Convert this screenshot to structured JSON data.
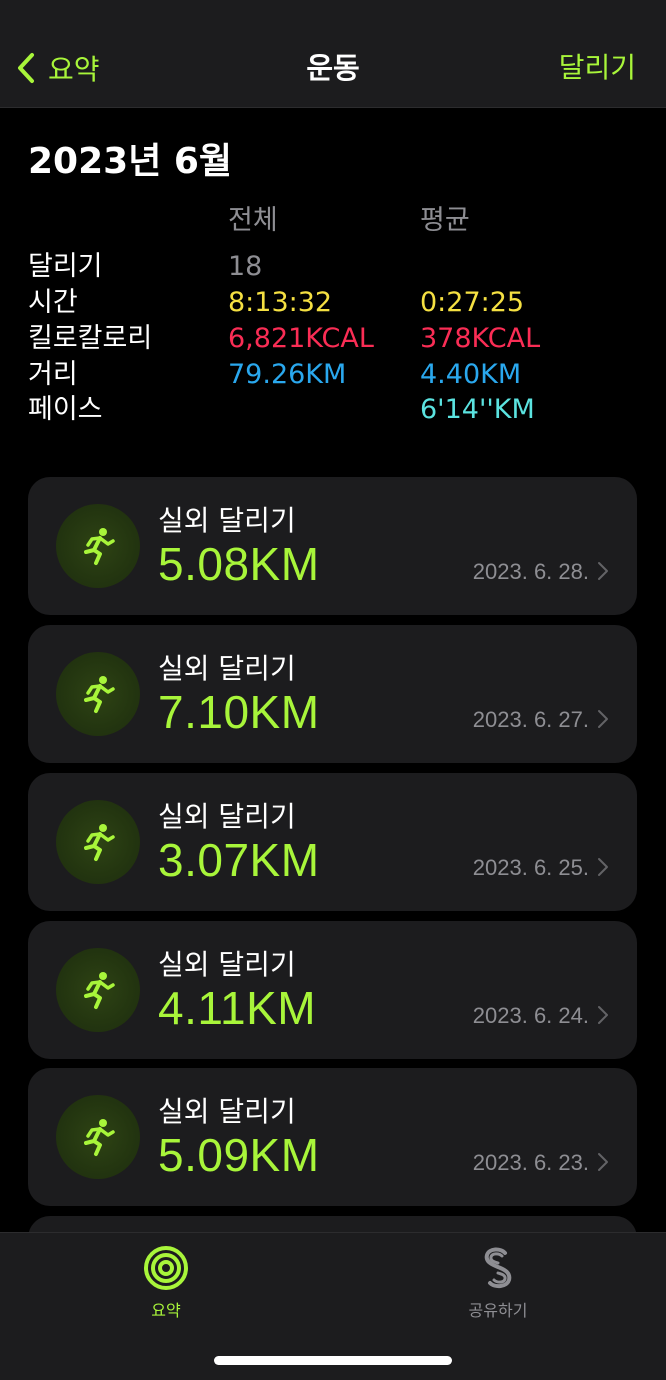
{
  "nav": {
    "back_label": "요약",
    "title": "운동",
    "right_label": "달리기"
  },
  "summary": {
    "month": "2023년 6월",
    "header_total": "전체",
    "header_average": "평균",
    "rows": [
      {
        "label": "달리기",
        "total": "18",
        "average": "",
        "color": "#8e8e93"
      },
      {
        "label": "시간",
        "total": "8:13:32",
        "average": "0:27:25",
        "color": "#f5e042"
      },
      {
        "label": "킬로칼로리",
        "total": "6,821KCAL",
        "average": "378KCAL",
        "color": "#fa2d55"
      },
      {
        "label": "거리",
        "total": "79.26KM",
        "average": "4.40KM",
        "color": "#2aa8ee"
      },
      {
        "label": "페이스",
        "total": "",
        "average": "6'14''KM",
        "color": "#5be3e0"
      }
    ]
  },
  "workouts": [
    {
      "type": "실외 달리기",
      "distance": "5.08KM",
      "date": "2023. 6. 28."
    },
    {
      "type": "실외 달리기",
      "distance": "7.10KM",
      "date": "2023. 6. 27."
    },
    {
      "type": "실외 달리기",
      "distance": "3.07KM",
      "date": "2023. 6. 25."
    },
    {
      "type": "실외 달리기",
      "distance": "4.11KM",
      "date": "2023. 6. 24."
    },
    {
      "type": "실외 달리기",
      "distance": "5.09KM",
      "date": "2023. 6. 23."
    }
  ],
  "tabs": {
    "summary_label": "요약",
    "share_label": "공유하기"
  },
  "colors": {
    "accent": "#a8f53a",
    "move": "#fa2d55",
    "exercise": "#a8f53a",
    "time": "#f5e042",
    "distance": "#2aa8ee",
    "pace": "#5be3e0",
    "secondary": "#8e8e93",
    "card": "#1c1c1e"
  },
  "icons": {
    "back": "chevron-left-icon",
    "workout": "running-figure-icon",
    "row_chevron": "chevron-right-icon",
    "summary_tab": "activity-rings-icon",
    "share_tab": "sharing-icon"
  }
}
